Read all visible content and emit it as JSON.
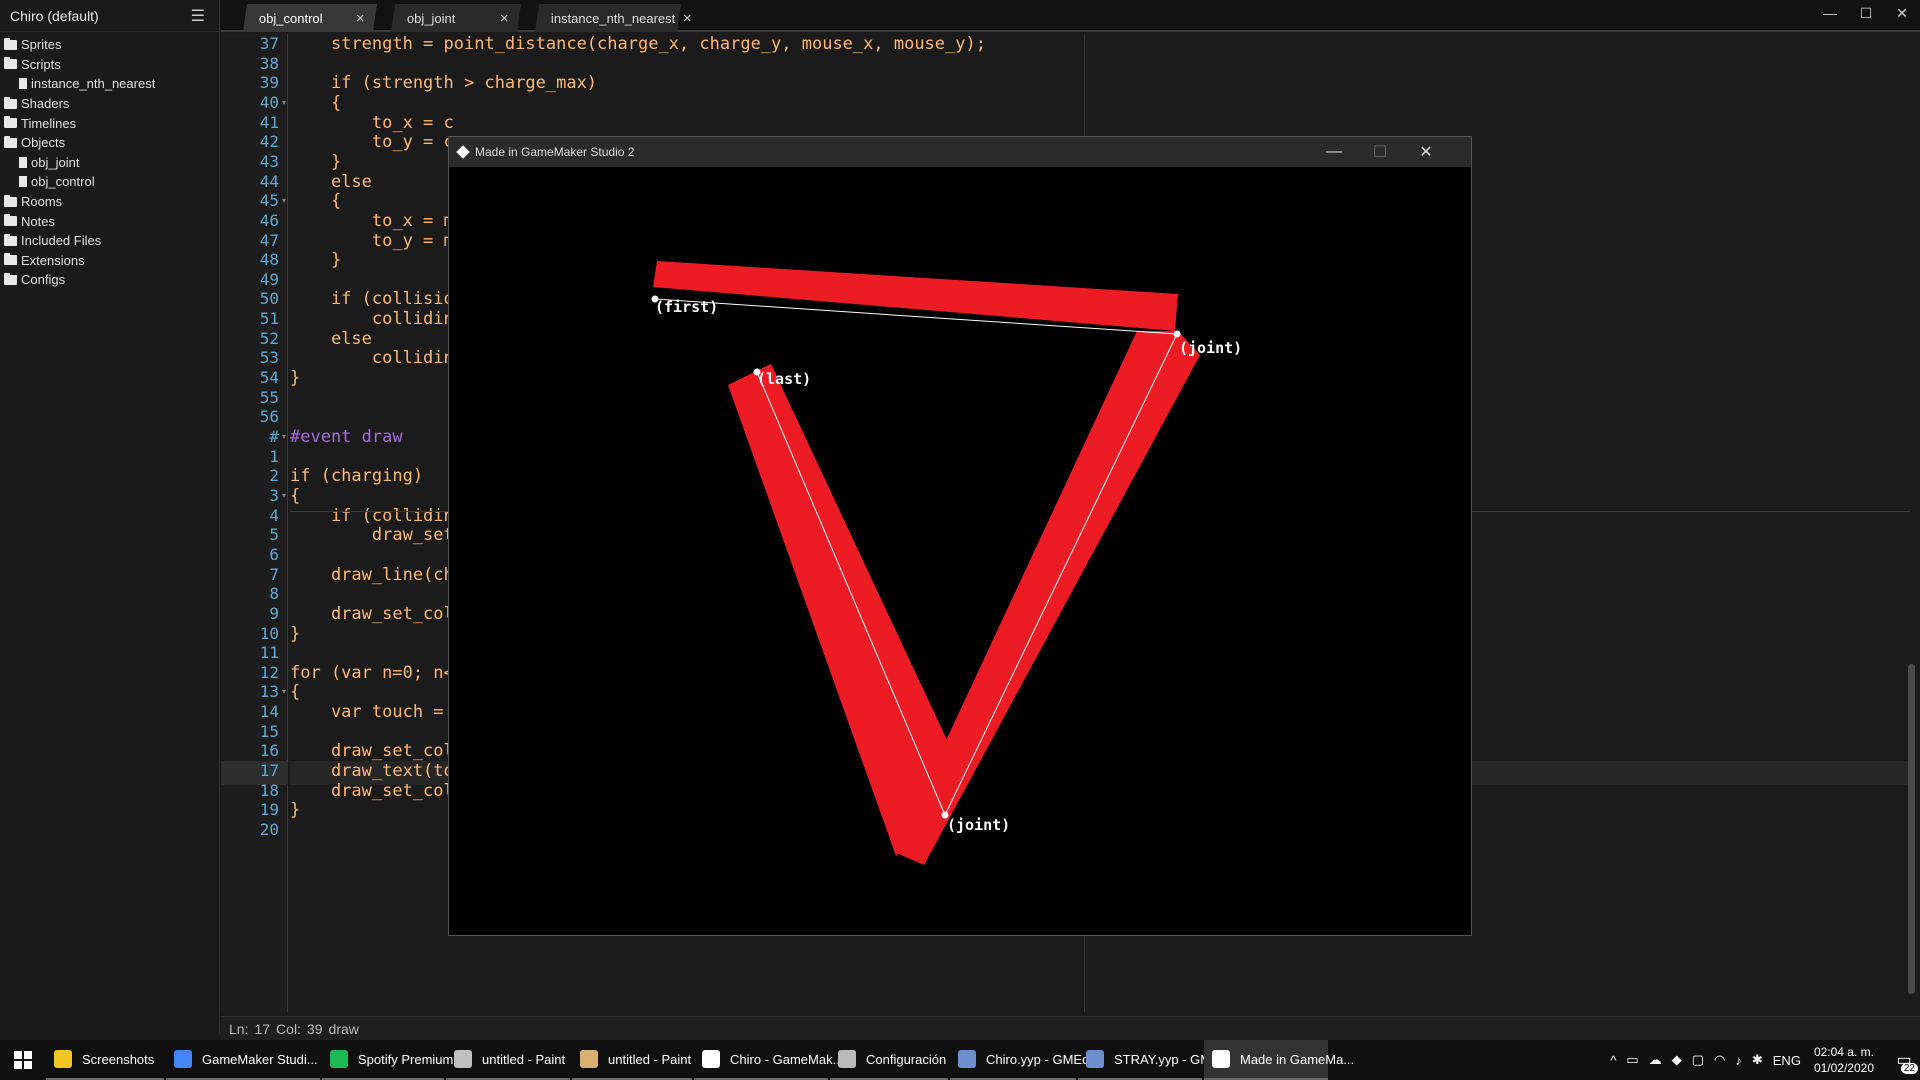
{
  "sidebar": {
    "title": "Chiro (default)",
    "items": [
      {
        "label": "Sprites",
        "type": "folder",
        "indent": 0
      },
      {
        "label": "Scripts",
        "type": "folder",
        "indent": 0
      },
      {
        "label": "instance_nth_nearest",
        "type": "file",
        "indent": 1
      },
      {
        "label": "Shaders",
        "type": "folder",
        "indent": 0
      },
      {
        "label": "Timelines",
        "type": "folder",
        "indent": 0
      },
      {
        "label": "Objects",
        "type": "folder",
        "indent": 0
      },
      {
        "label": "obj_joint",
        "type": "file",
        "indent": 1
      },
      {
        "label": "obj_control",
        "type": "file",
        "indent": 1
      },
      {
        "label": "Rooms",
        "type": "folder",
        "indent": 0
      },
      {
        "label": "Notes",
        "type": "folder",
        "indent": 0
      },
      {
        "label": "Included Files",
        "type": "folder",
        "indent": 0
      },
      {
        "label": "Extensions",
        "type": "folder",
        "indent": 0
      },
      {
        "label": "Configs",
        "type": "folder",
        "indent": 0
      }
    ]
  },
  "tabs": [
    {
      "label": "obj_control",
      "active": true
    },
    {
      "label": "obj_joint",
      "active": false
    },
    {
      "label": "instance_nth_nearest",
      "active": false
    }
  ],
  "editor": {
    "gutter": [
      "37",
      "38",
      "39",
      "40",
      "41",
      "42",
      "43",
      "44",
      "45",
      "46",
      "47",
      "48",
      "49",
      "50",
      "51",
      "52",
      "53",
      "54",
      "55",
      "56",
      "#",
      "1",
      "2",
      "3",
      "4",
      "5",
      "6",
      "7",
      "8",
      "9",
      "10",
      "11",
      "12",
      "13",
      "14",
      "15",
      "16",
      "17",
      "18",
      "19",
      "20"
    ],
    "folds": [
      40,
      45,
      "#",
      3,
      13
    ],
    "current_line_index": 37,
    "lines": [
      "    strength = point_distance(charge_x, charge_y, mouse_x, mouse_y);",
      "",
      "    if (strength > charge_max)",
      "    {",
      "        to_x = c",
      "        to_y = c",
      "    }",
      "    else",
      "    {",
      "        to_x = m",
      "        to_y = m",
      "    }",
      "",
      "    if (collisio",
      "        collidin",
      "    else",
      "        collidin",
      "}",
      "",
      "",
      "#event draw",
      "",
      "if (charging)",
      "{",
      "    if (collidin",
      "        draw_set",
      "",
      "    draw_line(ch",
      "",
      "    draw_set_col",
      "}",
      "",
      "for (var n=0; n<",
      "{",
      "    var touch = ",
      "",
      "    draw_set_col",
      "    draw_text(to",
      "    draw_set_color(c_white)",
      "}",
      ""
    ]
  },
  "status": {
    "ln_label": "Ln:",
    "ln": "17",
    "col_label": "Col:",
    "col": "39",
    "event": "draw"
  },
  "game_window": {
    "title": "Made in GameMaker Studio 2",
    "labels": {
      "first": "(first)",
      "joint1": "(joint)",
      "last": "(last)",
      "joint2": "(joint)"
    },
    "colors": {
      "beam": "#ed1c24",
      "line": "#ffffff",
      "point": "#ffffff"
    }
  },
  "taskbar": {
    "items": [
      {
        "label": "Screenshots",
        "color": "#f3c623"
      },
      {
        "label": "GameMaker Studi...",
        "color": "#4285f4"
      },
      {
        "label": "Spotify Premium",
        "color": "#1db954"
      },
      {
        "label": "untitled - Paint",
        "color": "#c0c0c0"
      },
      {
        "label": "untitled - Paint",
        "color": "#d8b070"
      },
      {
        "label": "Chiro - GameMak...",
        "color": "#ffffff"
      },
      {
        "label": "Configuración",
        "color": "#bbbbbb"
      },
      {
        "label": "Chiro.yyp - GMEdit",
        "color": "#6d8fcf"
      },
      {
        "label": "STRAY.yyp - GMEdit",
        "color": "#6d8fcf"
      },
      {
        "label": "Made in GameMa...",
        "color": "#ffffff",
        "active": true
      }
    ],
    "tray": {
      "lang": "ENG",
      "time": "02:04 a. m.",
      "date": "01/02/2020",
      "notifications": "22"
    }
  }
}
